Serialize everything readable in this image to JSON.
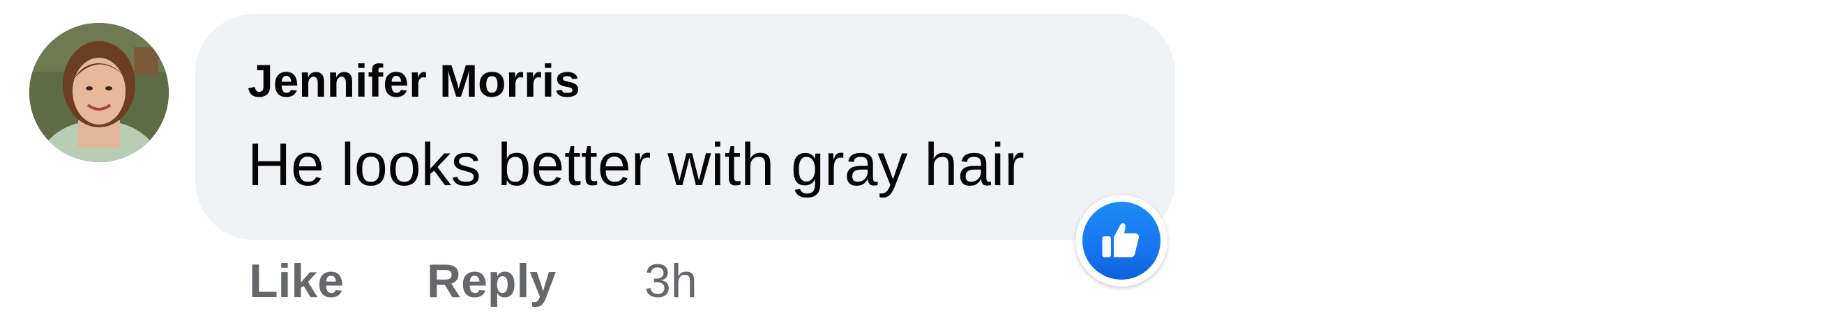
{
  "comment": {
    "author": "Jennifer Morris",
    "text": "He looks better with gray hair",
    "actions": {
      "like_label": "Like",
      "reply_label": "Reply",
      "timestamp": "3h"
    },
    "reaction_icon": "thumbs-up-icon",
    "colors": {
      "bubble": "#f0f2f5",
      "text": "#050505",
      "secondary_text": "#65676b",
      "reaction": "#1877f2"
    }
  }
}
